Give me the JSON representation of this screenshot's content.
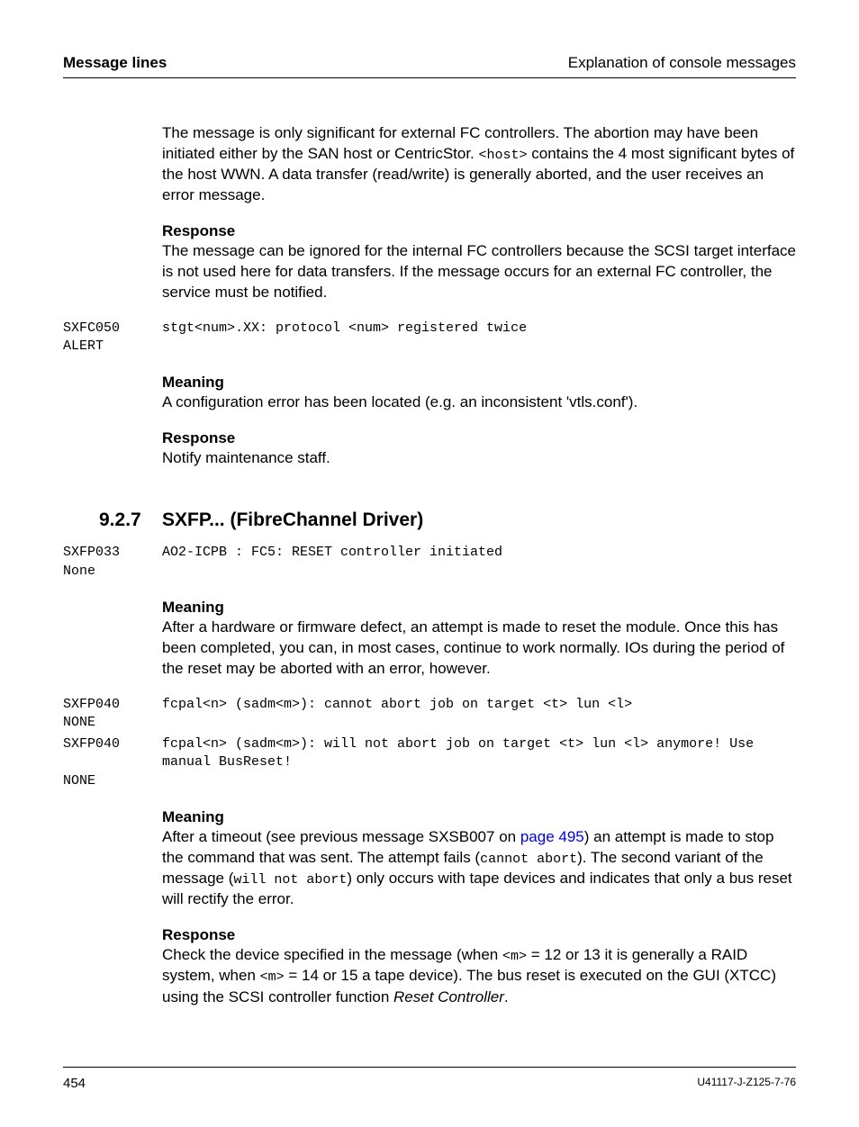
{
  "header": {
    "left": "Message lines",
    "right": "Explanation of console messages"
  },
  "p1": {
    "a": "The message is only significant for external FC controllers. The abortion may have been initiated either by the SAN host or CentricStor. ",
    "host": "<host>",
    "b": " contains the 4 most significant bytes of the host WWN. A data transfer (read/write) is generally aborted, and the user receives an error message."
  },
  "labels": {
    "response": "Response",
    "meaning": "Meaning"
  },
  "p2": "The message can be ignored for the internal FC controllers because the SCSI target interface is not used here for data transfers. If the message occurs for an external FC controller, the service must be notified.",
  "msg1": {
    "code": "SXFC050\nALERT",
    "text": "stgt<num>.XX: protocol <num> registered twice"
  },
  "p3": "A configuration error has been located (e.g. an inconsistent 'vtls.conf').",
  "p4": "Notify maintenance staff.",
  "section": {
    "num": "9.2.7",
    "title": "SXFP... (FibreChannel Driver)"
  },
  "msg2": {
    "code": "SXFP033\nNone",
    "text": "AO2-ICPB : FC5: RESET controller initiated"
  },
  "p5": "After a hardware or firmware defect, an attempt is made to reset the module. Once this has been completed, you can, in most cases, continue to work normally. IOs during the period of the reset may be aborted with an error, however.",
  "msg3": {
    "code": "SXFP040\nNONE",
    "text": "fcpal<n> (sadm<m>): cannot abort job on target <t> lun <l>"
  },
  "msg4": {
    "code": "SXFP040\n\nNONE",
    "text": "fcpal<n> (sadm<m>): will not abort job on target <t> lun <l> anymore! Use  manual BusReset!"
  },
  "p6": {
    "a": "After a timeout (see previous message SXSB007 on ",
    "link": "page 495",
    "b": ") an attempt is made to stop the command that was sent. The attempt fails (",
    "c1": "cannot abort",
    "c": "). The second variant of the message (",
    "c2": "will not abort",
    "d": ") only occurs with tape devices and indicates that only a bus reset will rectify the error."
  },
  "p7": {
    "a": "Check the device specified in the message (when ",
    "m1": "<m>",
    "b": "  = 12 or 13 it is generally a RAID system, when ",
    "m2": "<m>",
    "c": " = 14 or 15 a tape device). The bus reset is executed on the GUI (XTCC) using the SCSI controller function ",
    "italic": "Reset Controller",
    "d": "."
  },
  "footer": {
    "page": "454",
    "docid": "U41117-J-Z125-7-76"
  }
}
